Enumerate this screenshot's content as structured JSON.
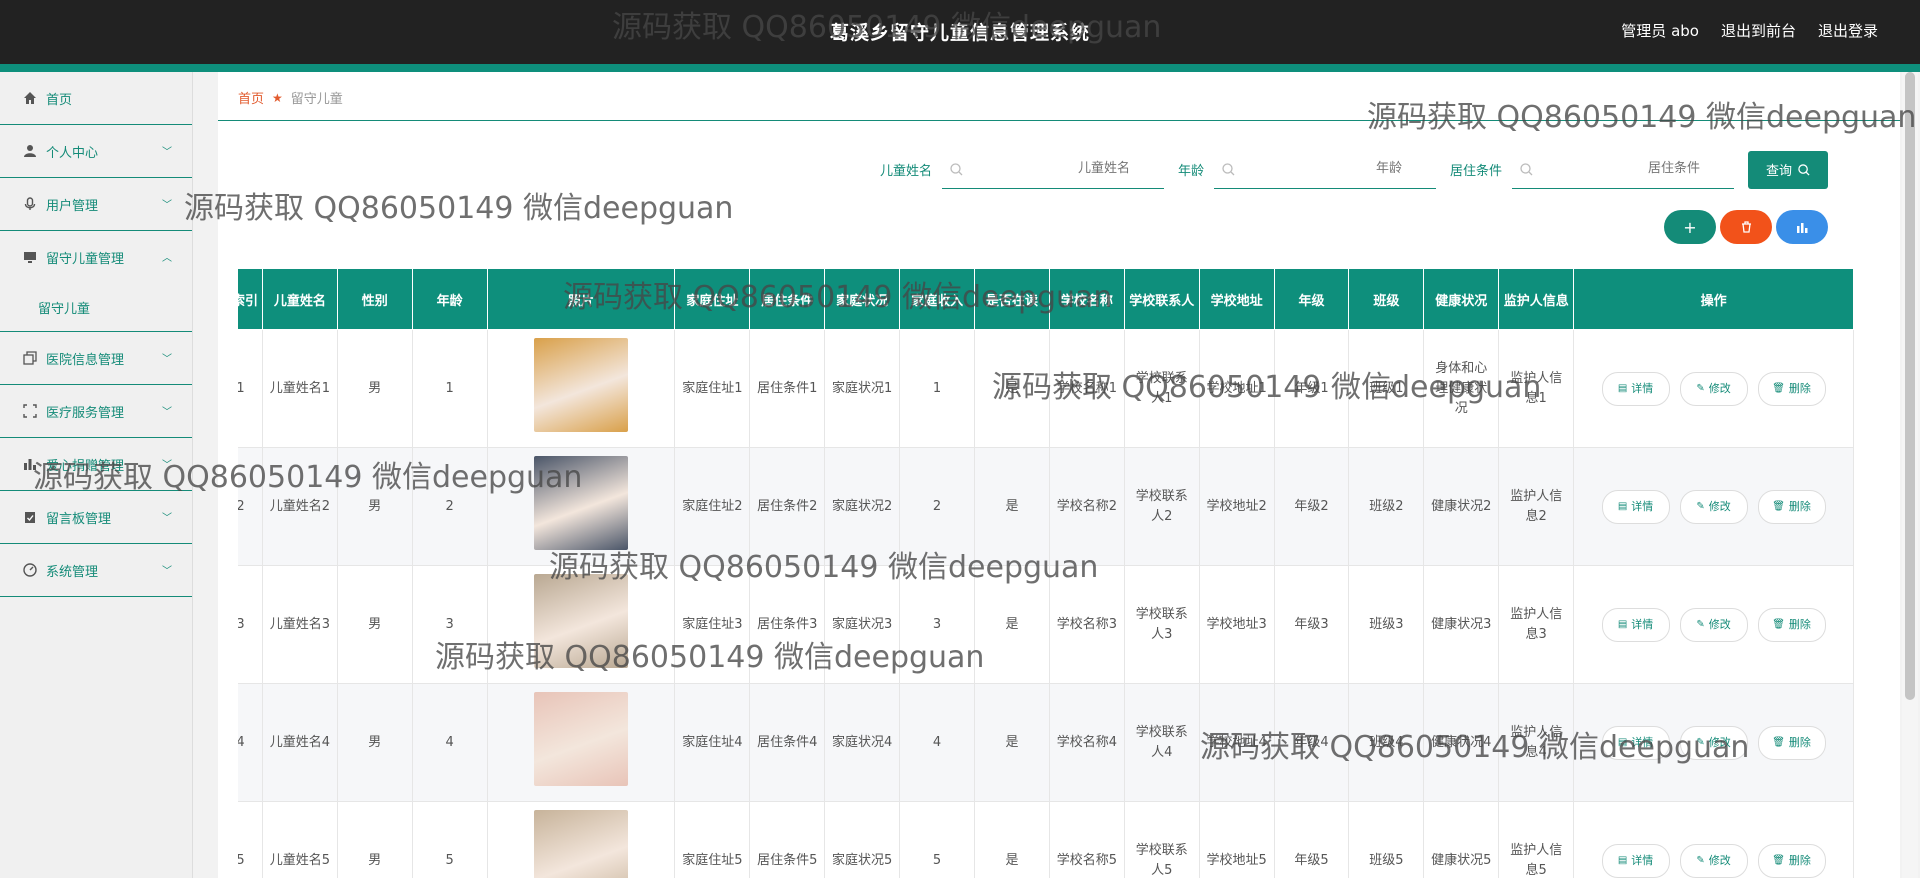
{
  "header": {
    "title": "葛溪乡留守儿童信息管理系统",
    "links": [
      "管理员 abo",
      "退出到前台",
      "退出登录"
    ]
  },
  "sidebar": {
    "items": [
      {
        "label": "首页",
        "icon": "home-icon"
      },
      {
        "label": "个人中心",
        "icon": "person-icon"
      },
      {
        "label": "用户管理",
        "icon": "mic-icon"
      },
      {
        "label": "留守儿童管理",
        "icon": "monitor-icon",
        "expanded": true,
        "sub": "留守儿童"
      },
      {
        "label": "医院信息管理",
        "icon": "copy-icon"
      },
      {
        "label": "医疗服务管理",
        "icon": "frame-icon"
      },
      {
        "label": "爱心捐赠管理",
        "icon": "bar-chart-icon"
      },
      {
        "label": "留言板管理",
        "icon": "clipboard-icon"
      },
      {
        "label": "系统管理",
        "icon": "gauge-icon"
      }
    ]
  },
  "breadcrumb": {
    "home": "首页",
    "current": "留守儿童"
  },
  "search": {
    "fields": [
      {
        "label": "儿童姓名",
        "placeholder": "儿童姓名"
      },
      {
        "label": "年龄",
        "placeholder": "年龄"
      },
      {
        "label": "居住条件",
        "placeholder": "居住条件"
      }
    ],
    "query_button": "查询"
  },
  "table": {
    "headers": [
      "索引",
      "儿童姓名",
      "性别",
      "年龄",
      "照片",
      "家庭住址",
      "居住条件",
      "家庭状况",
      "家庭收入",
      "是否在读",
      "学校名称",
      "学校联系人",
      "学校地址",
      "年级",
      "班级",
      "健康状况",
      "监护人信息",
      "操作"
    ],
    "rows": [
      {
        "idx": "1",
        "name": "儿童姓名1",
        "gender": "男",
        "age": "1",
        "photo": "#d9a04a",
        "address": "家庭住址1",
        "living": "居住条件1",
        "family": "家庭状况1",
        "income": "1",
        "studying": "是",
        "school": "学校名称1",
        "contact": "学校联系人1",
        "school_addr": "学校地址1",
        "grade": "年级1",
        "cls": "班级1",
        "health": "身体和心理健康状况",
        "guardian": "监护人信息1"
      },
      {
        "idx": "2",
        "name": "儿童姓名2",
        "gender": "男",
        "age": "2",
        "photo": "#4a5568",
        "address": "家庭住址2",
        "living": "居住条件2",
        "family": "家庭状况2",
        "income": "2",
        "studying": "是",
        "school": "学校名称2",
        "contact": "学校联系人2",
        "school_addr": "学校地址2",
        "grade": "年级2",
        "cls": "班级2",
        "health": "健康状况2",
        "guardian": "监护人信息2"
      },
      {
        "idx": "3",
        "name": "儿童姓名3",
        "gender": "男",
        "age": "3",
        "photo": "#b9a892",
        "address": "家庭住址3",
        "living": "居住条件3",
        "family": "家庭状况3",
        "income": "3",
        "studying": "是",
        "school": "学校名称3",
        "contact": "学校联系人3",
        "school_addr": "学校地址3",
        "grade": "年级3",
        "cls": "班级3",
        "health": "健康状况3",
        "guardian": "监护人信息3"
      },
      {
        "idx": "4",
        "name": "儿童姓名4",
        "gender": "男",
        "age": "4",
        "photo": "#e8c4b8",
        "address": "家庭住址4",
        "living": "居住条件4",
        "family": "家庭状况4",
        "income": "4",
        "studying": "是",
        "school": "学校名称4",
        "contact": "学校联系人4",
        "school_addr": "学校地址4",
        "grade": "年级4",
        "cls": "班级4",
        "health": "健康状况4",
        "guardian": "监护人信息4"
      },
      {
        "idx": "5",
        "name": "儿童姓名5",
        "gender": "男",
        "age": "5",
        "photo": "#c7b39a",
        "address": "家庭住址5",
        "living": "居住条件5",
        "family": "家庭状况5",
        "income": "5",
        "studying": "是",
        "school": "学校名称5",
        "contact": "学校联系人5",
        "school_addr": "学校地址5",
        "grade": "年级5",
        "cls": "班级5",
        "health": "健康状况5",
        "guardian": "监护人信息5"
      }
    ],
    "ops": [
      "详情",
      "修改",
      "删除"
    ]
  },
  "watermark": "源码获取 QQ86050149 微信deepguan",
  "colors": {
    "accent": "#148b78",
    "danger": "#f2521a",
    "info": "#3a8fe8",
    "topbar": "#222222"
  }
}
